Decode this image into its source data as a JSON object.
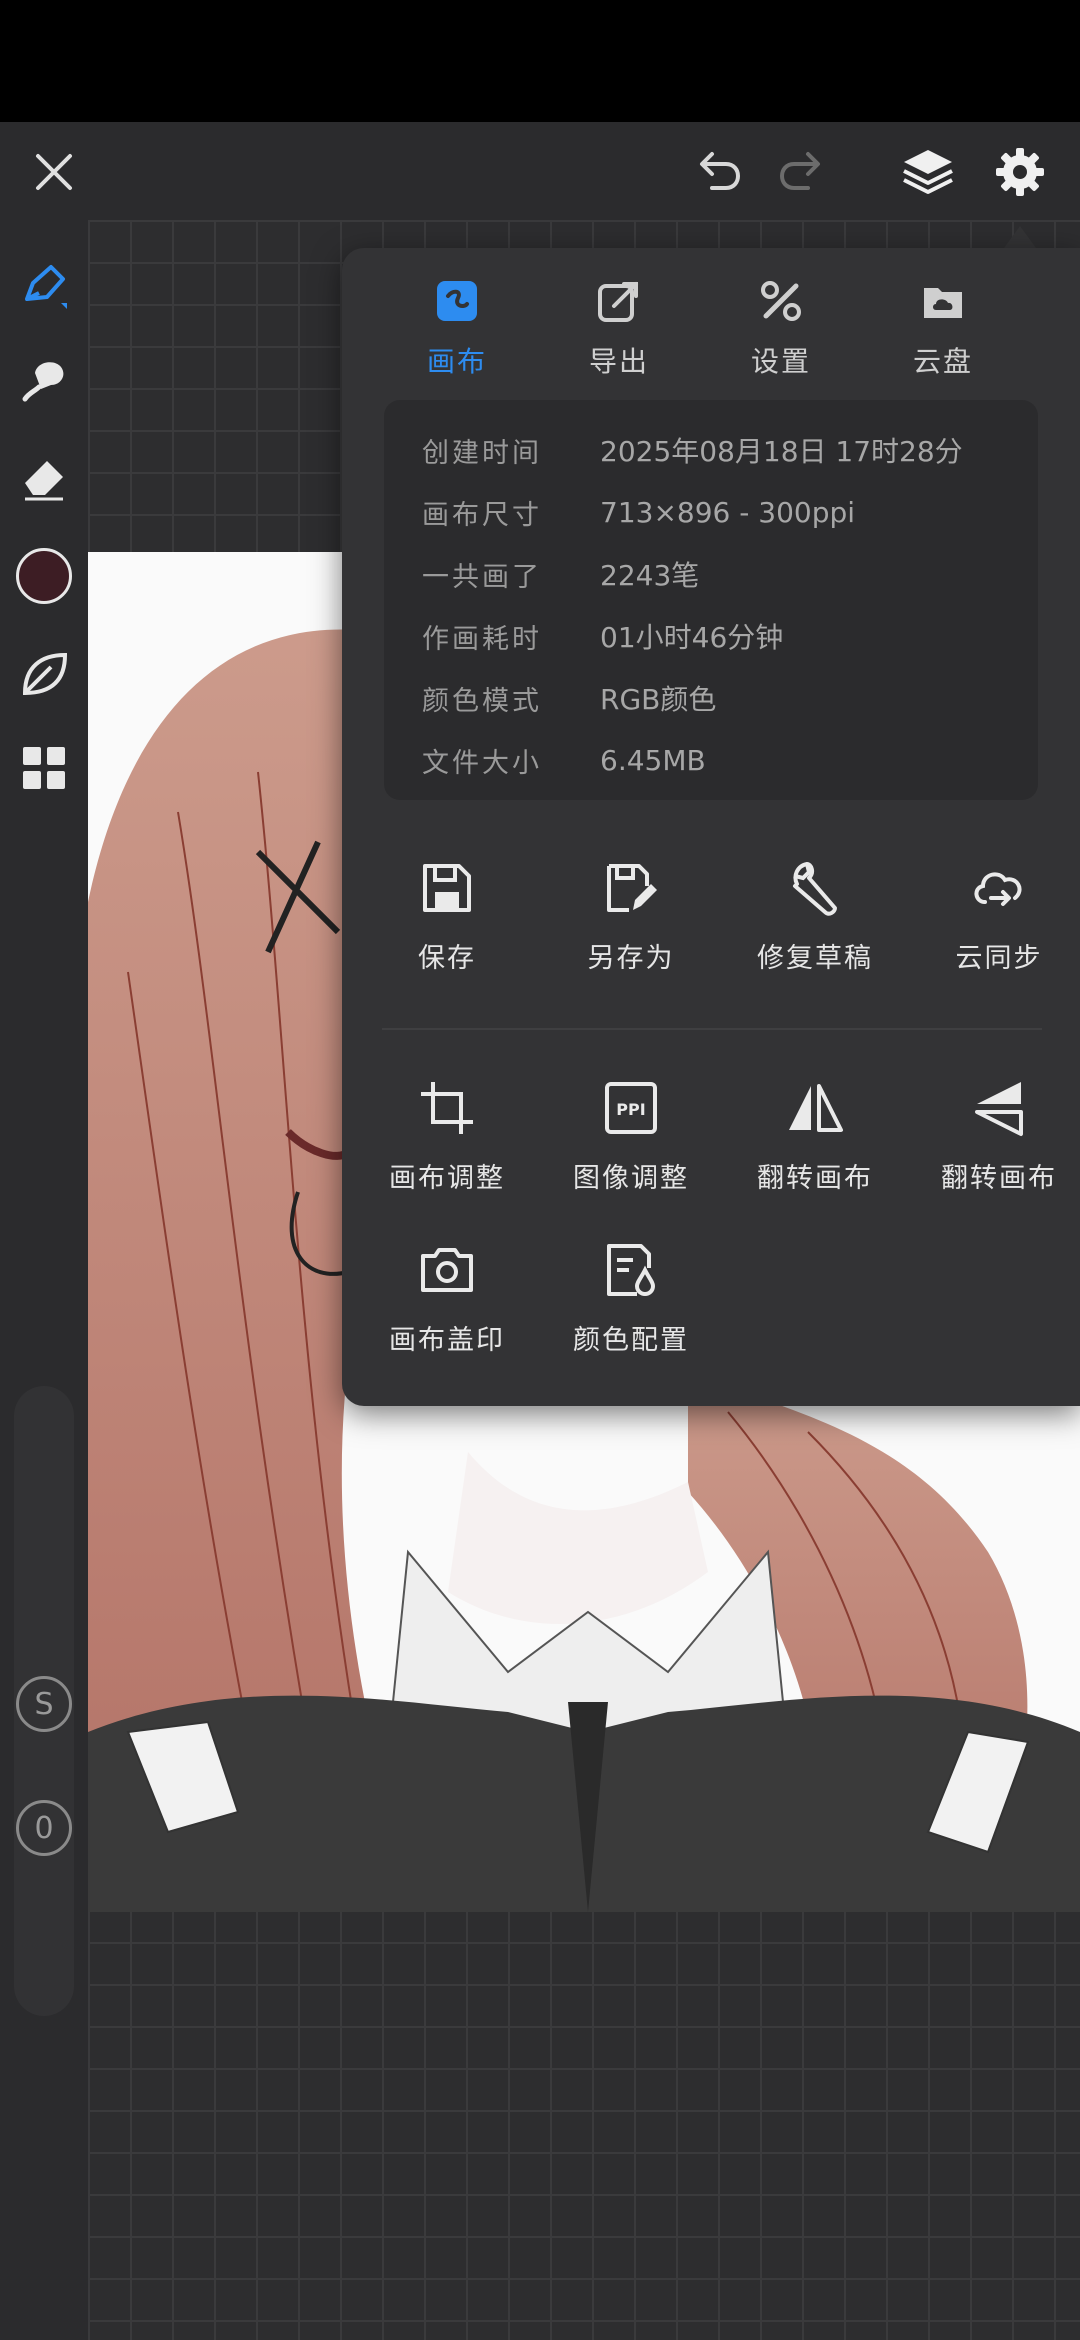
{
  "menu": {
    "tabs": [
      {
        "label": "画布",
        "icon": "canvas-icon",
        "active": true
      },
      {
        "label": "导出",
        "icon": "export-icon",
        "active": false
      },
      {
        "label": "设置",
        "icon": "tools-icon",
        "active": false
      },
      {
        "label": "云盘",
        "icon": "cloud-drive-icon",
        "active": false
      }
    ],
    "info": [
      {
        "label": "创建时间",
        "value": "2025年08月18日 17时28分"
      },
      {
        "label": "画布尺寸",
        "value": "713×896 - 300ppi"
      },
      {
        "label": "一共画了",
        "value": "2243笔"
      },
      {
        "label": "作画耗时",
        "value": "01小时46分钟"
      },
      {
        "label": "颜色模式",
        "value": "RGB颜色"
      },
      {
        "label": "文件大小",
        "value": "6.45MB"
      }
    ],
    "actions_row1": [
      {
        "label": "保存",
        "icon": "save-icon"
      },
      {
        "label": "另存为",
        "icon": "save-as-icon"
      },
      {
        "label": "修复草稿",
        "icon": "wrench-icon"
      },
      {
        "label": "云同步",
        "icon": "cloud-sync-icon"
      }
    ],
    "actions_row2": [
      {
        "label": "画布调整",
        "icon": "crop-icon"
      },
      {
        "label": "图像调整",
        "icon": "ppi-icon",
        "icon_text": "PPI"
      },
      {
        "label": "翻转画布",
        "icon": "flip-horizontal-icon"
      },
      {
        "label": "翻转画布",
        "icon": "flip-vertical-icon"
      }
    ],
    "actions_row3": [
      {
        "label": "画布盖印",
        "icon": "camera-icon"
      },
      {
        "label": "颜色配置",
        "icon": "color-config-icon"
      }
    ]
  },
  "left_toolbar": {
    "current_color": "#3d1d24",
    "slider_top_badge": "S",
    "slider_bottom_badge": "0"
  },
  "colors": {
    "accent": "#2d8cf0",
    "panel": "#333335",
    "toolbar": "#2b2b2d"
  }
}
